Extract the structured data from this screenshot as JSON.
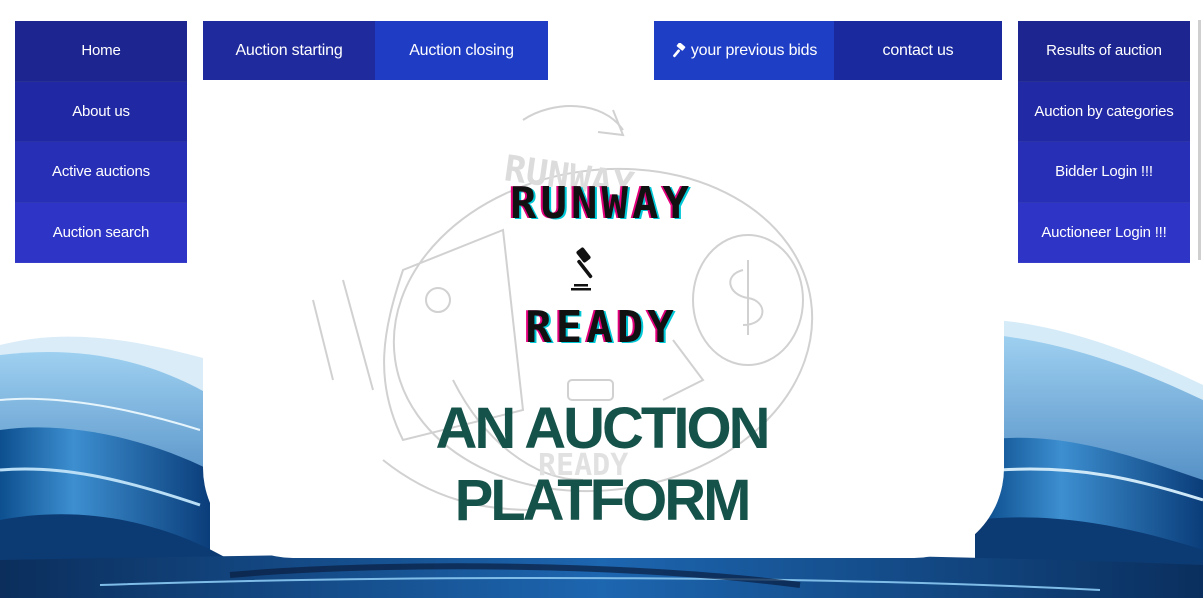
{
  "left_nav": [
    "Home",
    "About us",
    "Active auctions",
    "Auction search"
  ],
  "top_nav": {
    "auction_starting": "Auction starting",
    "auction_closing": "Auction closing",
    "previous_bids": "your previous bids",
    "contact": "contact us"
  },
  "right_nav": [
    "Results of auction",
    "Auction by categories",
    "Bidder Login !!!",
    "Auctioneer Login !!!"
  ],
  "logo": {
    "line1": "RUNWAY",
    "line2": "READY",
    "icon": "gavel-icon"
  },
  "tagline": {
    "line1": "AN AUCTION",
    "line2": "PLATFORM"
  },
  "colors": {
    "nav_dark": "#1c2a8f",
    "nav_mid": "#2431b4",
    "nav_bright": "#2f35c7",
    "accent_blue": "#1f3fc8",
    "tagline": "#15524a",
    "logo_text": "#111111"
  }
}
